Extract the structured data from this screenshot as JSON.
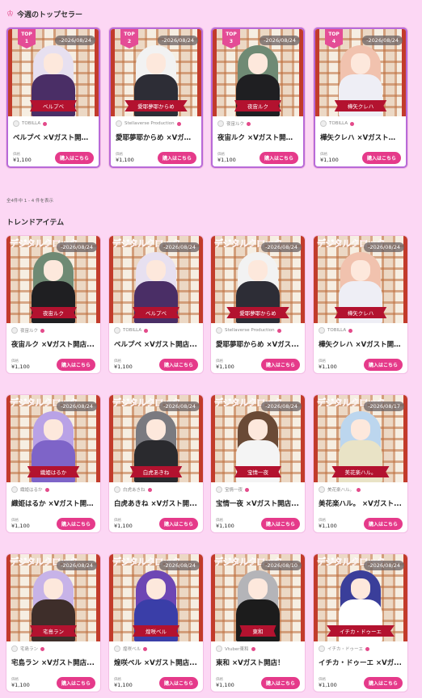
{
  "sections": {
    "top_title": "今週のトップセラー",
    "trend_title": "トレンドアイテム",
    "count_text": "全4件中 1 - 4 件を表示"
  },
  "labels": {
    "price": "価格",
    "buy": "購入はこちら",
    "digital_clock": "デジタルクロック"
  },
  "top_sellers": [
    {
      "rank": "1",
      "rank_label": "TOP",
      "seller": "TOBILLA",
      "name": "ベルプベ",
      "title": "ベルプベ ×Vガスト開店...",
      "price": "¥1,100",
      "date": "-2026/08/24",
      "hair": "#e7e0f0",
      "outfit": "#4a2e66"
    },
    {
      "rank": "2",
      "rank_label": "TOP",
      "seller": "Stellaverse Production",
      "name": "愛耶夢耶からめ",
      "title": "愛耶夢耶からめ ×Vガス...",
      "price": "¥1,100",
      "date": "-2026/08/24",
      "hair": "#f2f2f2",
      "outfit": "#2d2d36"
    },
    {
      "rank": "3",
      "rank_label": "TOP",
      "seller": "夜宙ルク",
      "name": "夜宙ルク",
      "title": "夜宙ルク ×Vガスト開店...",
      "price": "¥1,100",
      "date": "-2026/08/24",
      "hair": "#6f8a74",
      "outfit": "#1f1f22"
    },
    {
      "rank": "4",
      "rank_label": "TOP",
      "seller": "TOBILLA",
      "name": "樺矢クレハ",
      "title": "樺矢クレハ ×Vガスト開店...",
      "price": "¥1,100",
      "date": "-2026/08/24",
      "hair": "#f1c2ae",
      "outfit": "#eeeef5"
    }
  ],
  "trend_items": [
    {
      "seller": "夜宙ルク",
      "name": "夜宙ルク",
      "title": "夜宙ルク ×Vガスト開店...",
      "price": "¥1,100",
      "date": "-2026/08/24",
      "hair": "#6f8a74",
      "outfit": "#1f1f22"
    },
    {
      "seller": "TOBILLA",
      "name": "ベルプベ",
      "title": "ベルプベ ×Vガスト開店...",
      "price": "¥1,100",
      "date": "-2026/08/24",
      "hair": "#e7e0f0",
      "outfit": "#4a2e66"
    },
    {
      "seller": "Stellaverse Production",
      "name": "愛耶夢耶からめ",
      "title": "愛耶夢耶からめ ×Vガス...",
      "price": "¥1,100",
      "date": "-2026/08/24",
      "hair": "#f2f2f2",
      "outfit": "#2d2d36"
    },
    {
      "seller": "TOBILLA",
      "name": "樺矢クレハ",
      "title": "樺矢クレハ ×Vガスト開店...",
      "price": "¥1,100",
      "date": "-2026/08/24",
      "hair": "#f1c2ae",
      "outfit": "#eeeef5"
    },
    {
      "seller": "織姫はるか",
      "name": "織姫はるか",
      "title": "織姫はるか ×Vガスト開店...",
      "price": "¥1,100",
      "date": "-2026/08/24",
      "hair": "#b9a2e6",
      "outfit": "#7e64c8"
    },
    {
      "seller": "白虎あきね",
      "name": "白虎あきね",
      "title": "白虎あきね ×Vガスト開...",
      "price": "¥1,100",
      "date": "-2026/08/24",
      "hair": "#7a7a80",
      "outfit": "#2a2a2e"
    },
    {
      "seller": "宝情一夜",
      "name": "宝情一夜",
      "title": "宝情一夜 ×Vガスト開店...",
      "price": "¥1,100",
      "date": "-2026/08/24",
      "hair": "#6a4a36",
      "outfit": "#f4f4f4"
    },
    {
      "seller": "美花楽ハル。",
      "name": "美花楽ハル。",
      "title": "美花楽ハル。 ×Vガスト...",
      "price": "¥1,100",
      "date": "-2026/08/17",
      "hair": "#bcd6ee",
      "outfit": "#e9e3c6"
    },
    {
      "seller": "宅島ラン",
      "name": "宅島ラン",
      "title": "宅島ラン ×Vガスト開店...",
      "price": "¥1,100",
      "date": "-2026/08/24",
      "hair": "#c7b3e8",
      "outfit": "#3e2e2a"
    },
    {
      "seller": "煌咲ベル",
      "name": "煌咲ベル",
      "title": "煌咲ベル ×Vガスト開店...",
      "price": "¥1,100",
      "date": "-2026/08/24",
      "hair": "#6e46b4",
      "outfit": "#3a3ea8"
    },
    {
      "seller": "Vtuber東和",
      "name": "東和",
      "title": "東和 ×Vガスト開店！",
      "price": "¥1,100",
      "date": "-2026/08/10",
      "hair": "#b4b4b8",
      "outfit": "#1c1c1c"
    },
    {
      "seller": "イチカ・ドゥーエ",
      "name": "イチカ・ドゥーエ",
      "title": "イチカ・ドゥーエ ×Vガ...",
      "price": "¥1,100",
      "date": "-2026/08/24",
      "hair": "#3a3e9a",
      "outfit": "#ffffff"
    }
  ]
}
